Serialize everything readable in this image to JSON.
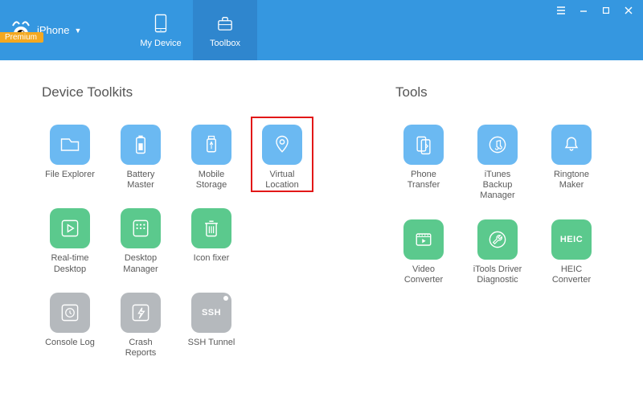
{
  "header": {
    "device_label": "iPhone",
    "ribbon": "Premium",
    "tabs": {
      "my_device": "My Device",
      "toolbox": "Toolbox"
    }
  },
  "sections": {
    "left_title": "Device Toolkits",
    "right_title": "Tools"
  },
  "toolkits": {
    "file_explorer": "File Explorer",
    "battery_master": "Battery Master",
    "mobile_storage": "Mobile Storage",
    "virtual_location": "Virtual Location",
    "realtime_desktop": "Real-time Desktop",
    "desktop_manager": "Desktop Manager",
    "icon_fixer": "Icon fixer",
    "console_log": "Console Log",
    "crash_reports": "Crash Reports",
    "ssh_tunnel": "SSH Tunnel"
  },
  "tools": {
    "phone_transfer": "Phone Transfer",
    "itunes_backup": "iTunes Backup Manager",
    "ringtone_maker": "Ringtone Maker",
    "video_converter": "Video Converter",
    "driver_diag": "iTools Driver Diagnostic",
    "heic_converter": "HEIC Converter"
  },
  "heic_text": "HEIC",
  "ssh_text": "SSH"
}
